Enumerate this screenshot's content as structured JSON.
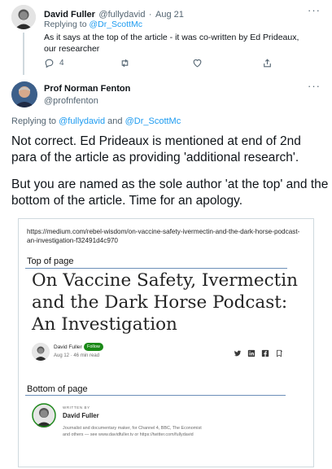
{
  "tweet1": {
    "author_name": "David Fuller",
    "author_handle": "@fullydavid",
    "separator": "·",
    "date": "Aug 21",
    "replying_prefix": "Replying to ",
    "replying_to": "@Dr_ScottMc",
    "text": "As it says at the top of the article - it was co-written by Ed Prideaux, our researcher",
    "more": "···",
    "actions": {
      "reply_icon": "reply-icon",
      "reply_count": "4",
      "retweet_icon": "retweet-icon",
      "like_icon": "heart-icon",
      "share_icon": "share-icon"
    }
  },
  "tweet2": {
    "author_name": "Prof Norman Fenton",
    "author_handle": "@profnfenton",
    "more": "···",
    "replying_prefix": "Replying to ",
    "replying_to_1": "@fullydavid",
    "replying_and": " and ",
    "replying_to_2": "@Dr_ScottMc",
    "text_p1": "Not correct. Ed Prideaux is mentioned at end of 2nd para of the article as providing 'additional research'.",
    "text_p2": "But you are named as the sole author 'at the top' and the bottom of the article. Time for an apology."
  },
  "embed": {
    "url": "https://medium.com/rebel-wisdom/on-vaccine-safety-ivermectin-and-the-dark-horse-podcast-an-investigation-f32491d4c970",
    "top_label": "Top of page",
    "article_title": "On Vaccine Safety, Ivermectin and the Dark Horse Podcast: An Investigation",
    "author_name": "David Fuller",
    "follow_label": "Follow",
    "author_meta": "Aug 12 · 46 min read",
    "share_icons": [
      "twitter-icon",
      "linkedin-icon",
      "facebook-icon",
      "bookmark-icon"
    ],
    "bottom_label": "Bottom of page",
    "written_by": "WRITTEN BY",
    "writer_name": "David Fuller",
    "writer_bio": "Journalist and documentary maker, for Channel 4, BBC, The Economist and others — see www.davidfuller.tv or https://twitter.com/fullydavid"
  },
  "colors": {
    "link": "#1d9bf0",
    "muted": "#536471",
    "follow_green": "#1a8917",
    "divider": "#6b8fb8"
  }
}
